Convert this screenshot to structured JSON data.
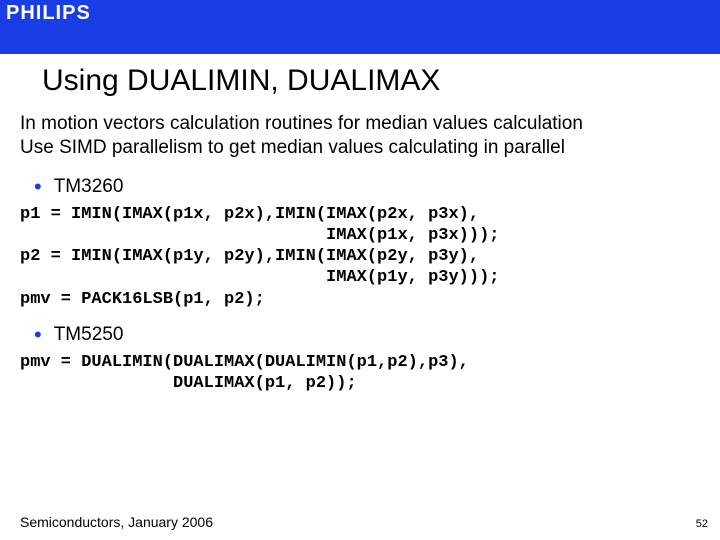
{
  "brand": {
    "name": "PHILIPS"
  },
  "slide": {
    "title": "Using DUALIMIN, DUALIMAX",
    "body_line1": "In motion vectors calculation routines for median values calculation",
    "body_line2": "Use SIMD parallelism to get median values calculating in parallel",
    "bullet1": "TM3260",
    "code1": "p1 = IMIN(IMAX(p1x, p2x),IMIN(IMAX(p2x, p3x),\n                              IMAX(p1x, p3x)));\np2 = IMIN(IMAX(p1y, p2y),IMIN(IMAX(p2y, p3y),\n                              IMAX(p1y, p3y)));\npmv = PACK16LSB(p1, p2);",
    "bullet2": "TM5250",
    "code2": "pmv = DUALIMIN(DUALIMAX(DUALIMIN(p1,p2),p3),\n               DUALIMAX(p1, p2));",
    "footer_text": "Semiconductors, January 2006",
    "page_number": "52"
  }
}
